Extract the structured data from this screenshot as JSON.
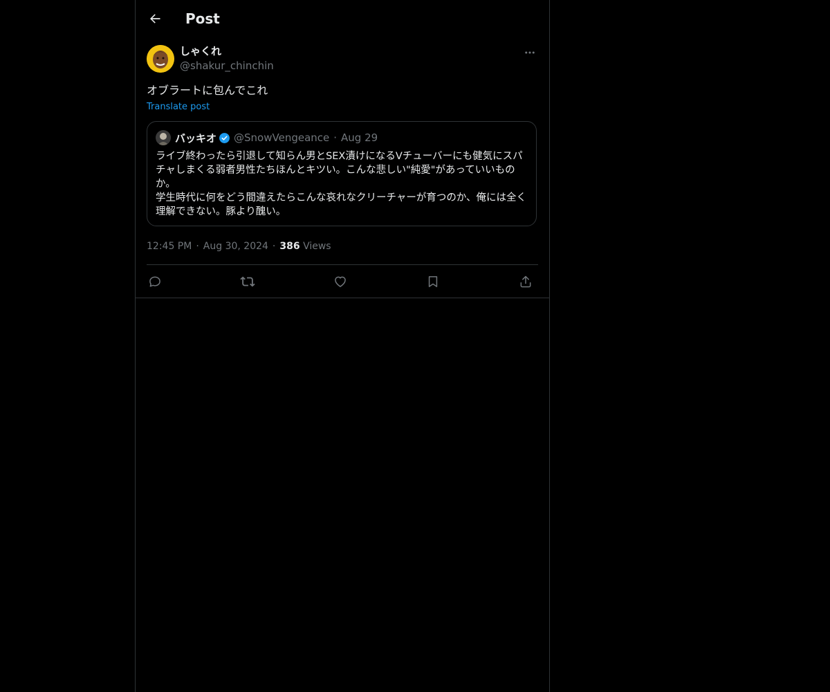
{
  "header": {
    "title": "Post"
  },
  "post": {
    "author": {
      "display_name": "しゃくれ",
      "handle": "@shakur_chinchin"
    },
    "text": "オブラートに包んでこれ",
    "translate_label": "Translate post",
    "timestamp": {
      "time": "12:45 PM",
      "date": "Aug 30, 2024",
      "views_count": "386",
      "views_label": "Views",
      "separator": "·"
    }
  },
  "quoted_post": {
    "display_name": "バッキオ",
    "handle": "@SnowVengeance",
    "separator": "·",
    "date": "Aug 29",
    "verified": true,
    "paragraphs": [
      "ライブ終わったら引退して知らん男とSEX漬けになるVチューバーにも健気にスパチャしまくる弱者男性たちほんとキツい。こんな悲しい\"純愛\"があっていいものか。",
      "学生時代に何をどう間違えたらこんな哀れなクリーチャーが育つのか、俺には全く理解できない。豚より醜い。"
    ]
  },
  "actions": [
    "reply-icon",
    "repost-icon",
    "like-icon",
    "bookmark-icon",
    "share-icon"
  ],
  "colors": {
    "background": "#000000",
    "text_primary": "#e7e9ea",
    "text_secondary": "#71767b",
    "accent": "#1d9bf0",
    "border": "#2f3336",
    "avatar_bg": "#f2c311"
  }
}
